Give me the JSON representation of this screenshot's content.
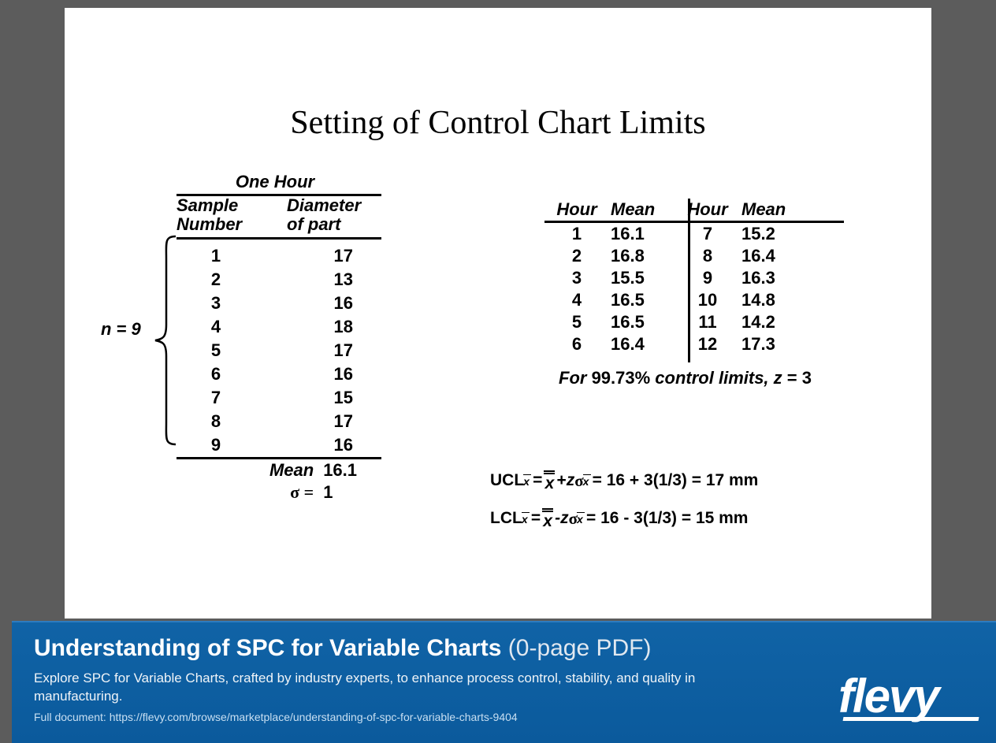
{
  "slide": {
    "title": "Setting of Control Chart Limits"
  },
  "left": {
    "caption": "One Hour",
    "headers": {
      "col1": "Sample Number",
      "col2": "Diameter of part"
    },
    "n_label": "n = 9",
    "rows": [
      {
        "num": "1",
        "dia": "17"
      },
      {
        "num": "2",
        "dia": "13"
      },
      {
        "num": "3",
        "dia": "16"
      },
      {
        "num": "4",
        "dia": "18"
      },
      {
        "num": "5",
        "dia": "17"
      },
      {
        "num": "6",
        "dia": "16"
      },
      {
        "num": "7",
        "dia": "15"
      },
      {
        "num": "8",
        "dia": "17"
      },
      {
        "num": "9",
        "dia": "16"
      }
    ],
    "summary": {
      "mean_label": "Mean",
      "mean_value": "16.1",
      "sigma_label": "σ =",
      "sigma_value": "1"
    }
  },
  "right": {
    "headers": {
      "h1": "Hour",
      "h2": "Mean",
      "h3": "Hour",
      "h4": "Mean"
    },
    "rows": [
      {
        "a": "1",
        "b": "16.1",
        "c": "7",
        "d": "15.2"
      },
      {
        "a": "2",
        "b": "16.8",
        "c": "8",
        "d": "16.4"
      },
      {
        "a": "3",
        "b": "15.5",
        "c": "9",
        "d": "16.3"
      },
      {
        "a": "4",
        "b": "16.5",
        "c": "10",
        "d": "14.8"
      },
      {
        "a": "5",
        "b": "16.5",
        "c": "11",
        "d": "14.2"
      },
      {
        "a": "6",
        "b": "16.4",
        "c": "12",
        "d": "17.3"
      }
    ],
    "note_prefix": "For ",
    "note_pct": "99.73%",
    "note_mid": " control limits, ",
    "note_z": "z",
    "note_eq": " = ",
    "note_val": "3"
  },
  "formulas": {
    "ucl_prefix": "UCL",
    "ucl_rest": " = 16 + 3(1/3) = 17 mm",
    "lcl_prefix": "LCL",
    "lcl_rest": " = 16 - 3(1/3) = 15 mm",
    "plus": " + ",
    "minus": " - ",
    "eq": " = ",
    "z": "z",
    "sigma": "σ"
  },
  "banner": {
    "title_main": "Understanding of SPC for Variable Charts",
    "title_suffix": " (0-page PDF)",
    "description": "Explore SPC for Variable Charts, crafted by industry experts, to enhance process control, stability, and quality in manufacturing.",
    "link_text": "Full document: https://flevy.com/browse/marketplace/understanding-of-spc-for-variable-charts-9404",
    "logo": "flevy"
  }
}
